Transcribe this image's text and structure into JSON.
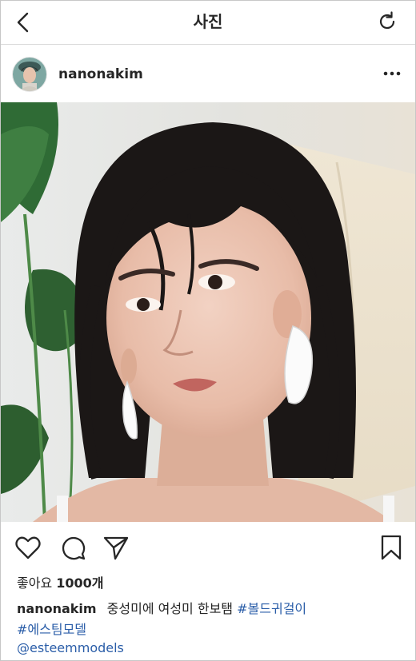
{
  "header": {
    "title": "사진",
    "back_icon": "chevron-left-icon",
    "refresh_icon": "refresh-icon"
  },
  "post": {
    "username": "nanonakim",
    "more_icon": "more-horizontal-icon",
    "photo_description_icon": "photo",
    "actions": {
      "like_icon": "heart-icon",
      "comment_icon": "comment-icon",
      "share_icon": "send-icon",
      "save_icon": "bookmark-icon"
    },
    "likes_label": "좋아요",
    "likes_count": "1000개",
    "caption_user": "nanonakim",
    "caption_text": "중성미에 여성미 한보탬",
    "hashtag_1": "#볼드귀걸이",
    "hashtag_2": "#에스팀모델",
    "mention": "@esteemmodels"
  },
  "colors": {
    "link": "#2a5da8",
    "text": "#262626",
    "divider": "#dbdbdb"
  }
}
